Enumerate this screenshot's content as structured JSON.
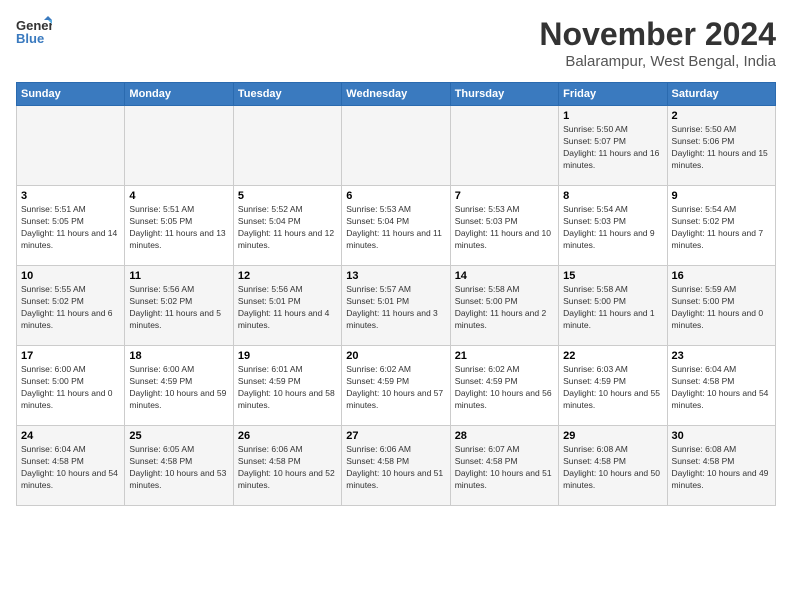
{
  "logo": {
    "line1": "General",
    "line2": "Blue"
  },
  "title": "November 2024",
  "subtitle": "Balarampur, West Bengal, India",
  "headers": [
    "Sunday",
    "Monday",
    "Tuesday",
    "Wednesday",
    "Thursday",
    "Friday",
    "Saturday"
  ],
  "weeks": [
    [
      {
        "day": "",
        "info": ""
      },
      {
        "day": "",
        "info": ""
      },
      {
        "day": "",
        "info": ""
      },
      {
        "day": "",
        "info": ""
      },
      {
        "day": "",
        "info": ""
      },
      {
        "day": "1",
        "info": "Sunrise: 5:50 AM\nSunset: 5:07 PM\nDaylight: 11 hours and 16 minutes."
      },
      {
        "day": "2",
        "info": "Sunrise: 5:50 AM\nSunset: 5:06 PM\nDaylight: 11 hours and 15 minutes."
      }
    ],
    [
      {
        "day": "3",
        "info": "Sunrise: 5:51 AM\nSunset: 5:05 PM\nDaylight: 11 hours and 14 minutes."
      },
      {
        "day": "4",
        "info": "Sunrise: 5:51 AM\nSunset: 5:05 PM\nDaylight: 11 hours and 13 minutes."
      },
      {
        "day": "5",
        "info": "Sunrise: 5:52 AM\nSunset: 5:04 PM\nDaylight: 11 hours and 12 minutes."
      },
      {
        "day": "6",
        "info": "Sunrise: 5:53 AM\nSunset: 5:04 PM\nDaylight: 11 hours and 11 minutes."
      },
      {
        "day": "7",
        "info": "Sunrise: 5:53 AM\nSunset: 5:03 PM\nDaylight: 11 hours and 10 minutes."
      },
      {
        "day": "8",
        "info": "Sunrise: 5:54 AM\nSunset: 5:03 PM\nDaylight: 11 hours and 9 minutes."
      },
      {
        "day": "9",
        "info": "Sunrise: 5:54 AM\nSunset: 5:02 PM\nDaylight: 11 hours and 7 minutes."
      }
    ],
    [
      {
        "day": "10",
        "info": "Sunrise: 5:55 AM\nSunset: 5:02 PM\nDaylight: 11 hours and 6 minutes."
      },
      {
        "day": "11",
        "info": "Sunrise: 5:56 AM\nSunset: 5:02 PM\nDaylight: 11 hours and 5 minutes."
      },
      {
        "day": "12",
        "info": "Sunrise: 5:56 AM\nSunset: 5:01 PM\nDaylight: 11 hours and 4 minutes."
      },
      {
        "day": "13",
        "info": "Sunrise: 5:57 AM\nSunset: 5:01 PM\nDaylight: 11 hours and 3 minutes."
      },
      {
        "day": "14",
        "info": "Sunrise: 5:58 AM\nSunset: 5:00 PM\nDaylight: 11 hours and 2 minutes."
      },
      {
        "day": "15",
        "info": "Sunrise: 5:58 AM\nSunset: 5:00 PM\nDaylight: 11 hours and 1 minute."
      },
      {
        "day": "16",
        "info": "Sunrise: 5:59 AM\nSunset: 5:00 PM\nDaylight: 11 hours and 0 minutes."
      }
    ],
    [
      {
        "day": "17",
        "info": "Sunrise: 6:00 AM\nSunset: 5:00 PM\nDaylight: 11 hours and 0 minutes."
      },
      {
        "day": "18",
        "info": "Sunrise: 6:00 AM\nSunset: 4:59 PM\nDaylight: 10 hours and 59 minutes."
      },
      {
        "day": "19",
        "info": "Sunrise: 6:01 AM\nSunset: 4:59 PM\nDaylight: 10 hours and 58 minutes."
      },
      {
        "day": "20",
        "info": "Sunrise: 6:02 AM\nSunset: 4:59 PM\nDaylight: 10 hours and 57 minutes."
      },
      {
        "day": "21",
        "info": "Sunrise: 6:02 AM\nSunset: 4:59 PM\nDaylight: 10 hours and 56 minutes."
      },
      {
        "day": "22",
        "info": "Sunrise: 6:03 AM\nSunset: 4:59 PM\nDaylight: 10 hours and 55 minutes."
      },
      {
        "day": "23",
        "info": "Sunrise: 6:04 AM\nSunset: 4:58 PM\nDaylight: 10 hours and 54 minutes."
      }
    ],
    [
      {
        "day": "24",
        "info": "Sunrise: 6:04 AM\nSunset: 4:58 PM\nDaylight: 10 hours and 54 minutes."
      },
      {
        "day": "25",
        "info": "Sunrise: 6:05 AM\nSunset: 4:58 PM\nDaylight: 10 hours and 53 minutes."
      },
      {
        "day": "26",
        "info": "Sunrise: 6:06 AM\nSunset: 4:58 PM\nDaylight: 10 hours and 52 minutes."
      },
      {
        "day": "27",
        "info": "Sunrise: 6:06 AM\nSunset: 4:58 PM\nDaylight: 10 hours and 51 minutes."
      },
      {
        "day": "28",
        "info": "Sunrise: 6:07 AM\nSunset: 4:58 PM\nDaylight: 10 hours and 51 minutes."
      },
      {
        "day": "29",
        "info": "Sunrise: 6:08 AM\nSunset: 4:58 PM\nDaylight: 10 hours and 50 minutes."
      },
      {
        "day": "30",
        "info": "Sunrise: 6:08 AM\nSunset: 4:58 PM\nDaylight: 10 hours and 49 minutes."
      }
    ]
  ]
}
